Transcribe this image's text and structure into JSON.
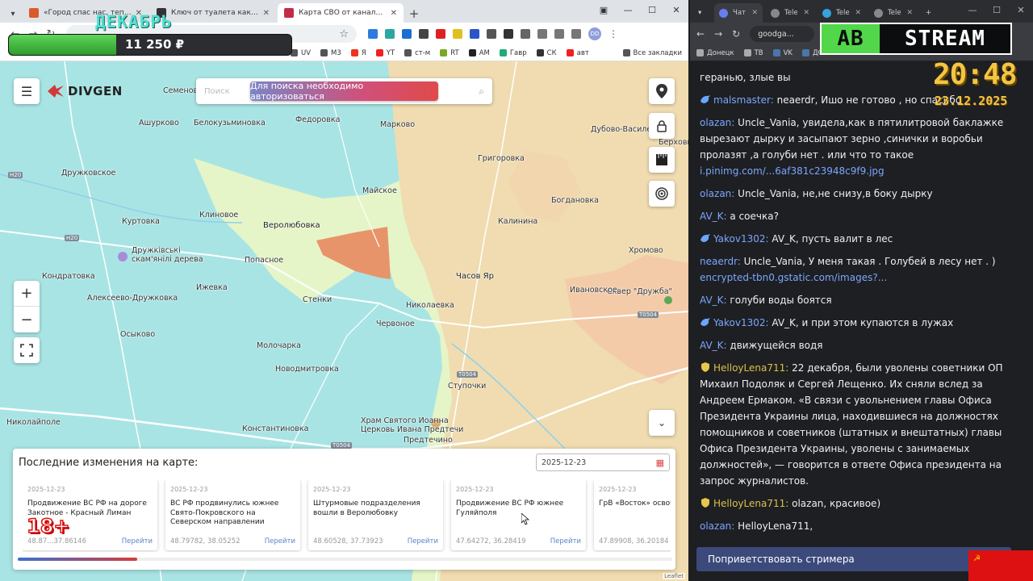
{
  "left_browser": {
    "tabs": [
      {
        "label": "«Город спас нас, теперь мы б",
        "fav": "#d95c2a"
      },
      {
        "label": "Ключ от туалета как культурн",
        "fav": "#333333"
      },
      {
        "label": "Карта СВО от канала DIVGEN",
        "fav": "#c22c4a",
        "active": true
      }
    ],
    "bookmarks": [
      {
        "label": "UV",
        "c": "#555"
      },
      {
        "label": "M3",
        "c": "#555"
      },
      {
        "label": "Я",
        "c": "#e32"
      },
      {
        "label": "YT",
        "c": "#e22"
      },
      {
        "label": "ст-м",
        "c": "#555"
      },
      {
        "label": "RT",
        "c": "#7a2"
      },
      {
        "label": "AM",
        "c": "#222"
      },
      {
        "label": "Гавр",
        "c": "#2a7"
      },
      {
        "label": "СК",
        "c": "#333"
      },
      {
        "label": "авт",
        "c": "#e22"
      }
    ],
    "all_bookmarks": "Все закладки",
    "profile": "DD"
  },
  "stream_overlay": {
    "month": "ДЕКАБРЬ",
    "donation_amount": "11 250 ₽",
    "donation_progress": 0.38,
    "logo_left": "AB",
    "logo_right": "STREAM",
    "clock": "20:48",
    "date": "23.12.2025",
    "age_rating": "18+"
  },
  "map": {
    "brand": "DIVGEN",
    "search_placeholder": "Поиск",
    "auth_warning": "Для поиска необходимо авторизоваться",
    "zoom_in": "+",
    "zoom_out": "−",
    "places": [
      "Семеновка",
      "Ашурково",
      "Белокузьминовка",
      "Федоровка",
      "Марково",
      "Дубово-Василевка",
      "Берховка",
      "Дружковское",
      "Майское",
      "Григоровка",
      "Богдановка",
      "Клиновое",
      "Веролюбовка",
      "Калинина",
      "Куртовка",
      "Дружківські скам'янілі дерева",
      "Хромово",
      "Попасное",
      "Кондратовка",
      "Часов Яр",
      "Алексеево-Дружковка",
      "Ижевка",
      "Стенки",
      "Николаевка",
      "Сквер \"Дружба\"",
      "Ивановское",
      "Осыково",
      "Червоное",
      "Молочарка",
      "Новодмитровка",
      "Ступочки",
      "Николайполе",
      "Константиновка",
      "Храм Святого Иоанна",
      "Церковь Ивана Предтечи",
      "Предтечино"
    ],
    "roads": [
      "H20",
      "H20",
      "T0504",
      "T0504",
      "T0504"
    ],
    "leaflet": "Leaflet"
  },
  "changes": {
    "heading": "Последние изменения на карте:",
    "date_value": "2025-12-23",
    "go_label": "Перейти",
    "cards": [
      {
        "date": "2025-12-23",
        "title": "Продвижение ВС РФ на дороге Закотное - Красный Лиман",
        "coords": "48.87...37.86146"
      },
      {
        "date": "2025-12-23",
        "title": "ВС РФ продвинулись южнее Свято-Покровского на Северском направлении",
        "coords": "48.79782, 38.05252"
      },
      {
        "date": "2025-12-23",
        "title": "Штурмовые подразделения вошли в Веролюбовку",
        "coords": "48.60528, 37.73923"
      },
      {
        "date": "2025-12-23",
        "title": "Продвижение ВС РФ южнее Гуляйполя",
        "coords": "47.64272, 36.28419"
      },
      {
        "date": "2025-12-23",
        "title": "ГрВ «Восток» освобо Андреевку",
        "coords": "47.89908, 36.20184"
      }
    ]
  },
  "right_browser": {
    "tabs": [
      {
        "label": "Чат",
        "fav": "#6a7df0",
        "active": true
      },
      {
        "label": "Tele",
        "fav": "#888"
      },
      {
        "label": "Tele",
        "fav": "#35a3e0"
      },
      {
        "label": "Tele",
        "fav": "#888"
      }
    ],
    "omnibox": "goodga...",
    "bookmarks": [
      "Донецк",
      "ТВ",
      "VK",
      "ДС"
    ]
  },
  "chat": {
    "greet_button": "Поприветствовать стримера",
    "messages": [
      {
        "user": "",
        "text": "геранью, злые вы",
        "color": "#efeff1"
      },
      {
        "user": "malsmaster",
        "text": "neaerdr, Ишо не готово , но спасибо",
        "color": "#7aa6ff",
        "badge": "bird"
      },
      {
        "user": "olazan",
        "text": "Uncle_Vania, увидела,как в пятилитровой баклажке вырезают дырку и засыпают зерно ,синички и воробьи пролазят ,а голуби нет . или что то такое",
        "link": "i.pinimg.com/...6af381c23948c9f9.jpg",
        "color": "#7aa6ff"
      },
      {
        "user": "olazan",
        "text": "Uncle_Vania, не,не снизу,в боку дырку",
        "color": "#7aa6ff"
      },
      {
        "user": "AV_K",
        "text": "а соечка?",
        "color": "#7aa6ff"
      },
      {
        "user": "Yakov1302",
        "text": "AV_K, пусть валит в лес",
        "color": "#7aa6ff",
        "badge": "bird"
      },
      {
        "user": "neaerdr",
        "text": "Uncle_Vania, У меня такая . Голубей в лесу нет . )",
        "link": "encrypted-tbn0.gstatic.com/images?...",
        "color": "#7aa6ff"
      },
      {
        "user": "AV_K",
        "text": "голуби воды боятся",
        "color": "#7aa6ff"
      },
      {
        "user": "Yakov1302",
        "text": "AV_K, и при этом купаются в лужах",
        "color": "#7aa6ff",
        "badge": "bird"
      },
      {
        "user": "AV_K",
        "text": "движущейся водя",
        "color": "#7aa6ff"
      },
      {
        "user": "HelloyLena711",
        "text": "22 декабря, были уволены советники ОП Михаил Подоляк и Сергей Лещенко. Их сняли вслед за Андреем Ермаком. «В связи с увольнением главы Офиса Президента Украины лица, находившиеся на должностях помощников и советников (штатных и внештатных) главы Офиса Президента Украины, уволены с занимаемых должностей», — говорится в ответе Офиса президента на запрос журналистов.",
        "color": "#d8c24a",
        "badge": "shield"
      },
      {
        "user": "HelloyLena711",
        "text": "olazan, красивое)",
        "color": "#d8c24a",
        "badge": "shield"
      },
      {
        "user": "olazan",
        "text": "HelloyLena711,",
        "color": "#7aa6ff"
      }
    ]
  }
}
